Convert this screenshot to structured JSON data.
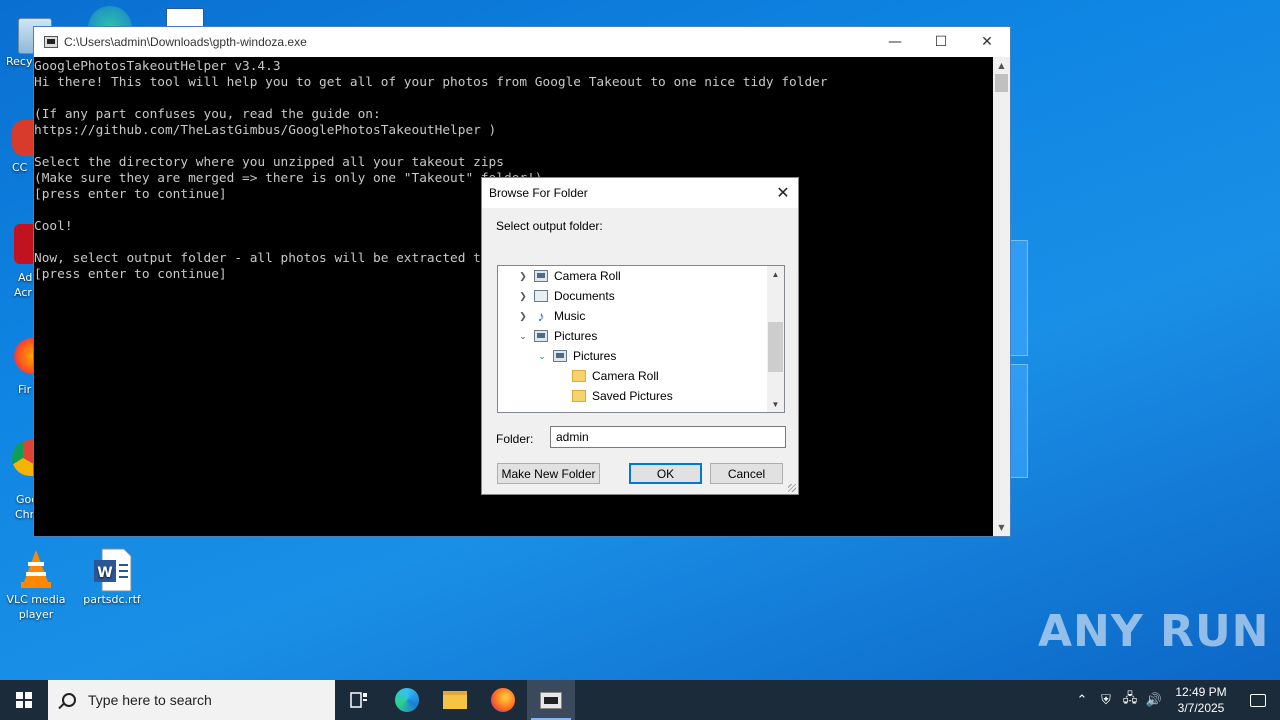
{
  "desktop": {
    "icons": [
      {
        "name": "recycle-bin",
        "label": "Recy"
      },
      {
        "name": "ccleaner",
        "label": "CC"
      },
      {
        "name": "acrobat",
        "label": "Ad\nAcr"
      },
      {
        "name": "firefox",
        "label": "Fir"
      },
      {
        "name": "chrome",
        "label": "Goo\nChr"
      },
      {
        "name": "vlc",
        "label": "VLC media player"
      },
      {
        "name": "partsdc",
        "label": "partsdc.rtf"
      }
    ],
    "partial_labels": {
      "recycle": "Recy",
      "ccleaner": "CC",
      "acrobat_1": "Ad",
      "acrobat_2": "Acr",
      "firefox": "Fir",
      "chrome_1": "Goo",
      "chrome_2": "Chr"
    },
    "vlc_label": "VLC media player",
    "word_label": "partsdc.rtf"
  },
  "console": {
    "title": "C:\\Users\\admin\\Downloads\\gpth-windoza.exe",
    "lines": [
      "GooglePhotosTakeoutHelper v3.4.3",
      "Hi there! This tool will help you to get all of your photos from Google Takeout to one nice tidy folder",
      "",
      "(If any part confuses you, read the guide on:",
      "https://github.com/TheLastGimbus/GooglePhotosTakeoutHelper )",
      "",
      "Select the directory where you unzipped all your takeout zips",
      "(Make sure they are merged => there is only one \"Takeout\" folder!)",
      "[press enter to continue]",
      "",
      "Cool!",
      "",
      "Now, select output folder - all photos will be extracted there",
      "[press enter to continue]"
    ]
  },
  "dialog": {
    "title": "Browse For Folder",
    "prompt": "Select output folder:",
    "tree": [
      {
        "label": "Camera Roll",
        "expander": "collapsed",
        "icon": "pictures-library-icon"
      },
      {
        "label": "Documents",
        "expander": "collapsed",
        "icon": "documents-icon"
      },
      {
        "label": "Music",
        "expander": "collapsed",
        "icon": "music-icon"
      },
      {
        "label": "Pictures",
        "expander": "expanded",
        "icon": "pictures-library-icon"
      },
      {
        "label": "Pictures",
        "expander": "expanded",
        "icon": "pictures-library-icon"
      },
      {
        "label": "Camera Roll",
        "expander": "none",
        "icon": "folder-icon"
      },
      {
        "label": "Saved Pictures",
        "expander": "none",
        "icon": "folder-icon"
      }
    ],
    "folder_label": "Folder:",
    "folder_value": "admin",
    "buttons": {
      "new_folder": "Make New Folder",
      "ok": "OK",
      "cancel": "Cancel"
    }
  },
  "taskbar": {
    "search_placeholder": "Type here to search",
    "time": "12:49 PM",
    "date": "3/7/2025"
  },
  "watermark": "ANY RUN",
  "colors": {
    "console_bg": "#000000",
    "console_text": "#c8c8c8",
    "taskbar": "#1c2b3a",
    "accent": "#0078d7"
  }
}
